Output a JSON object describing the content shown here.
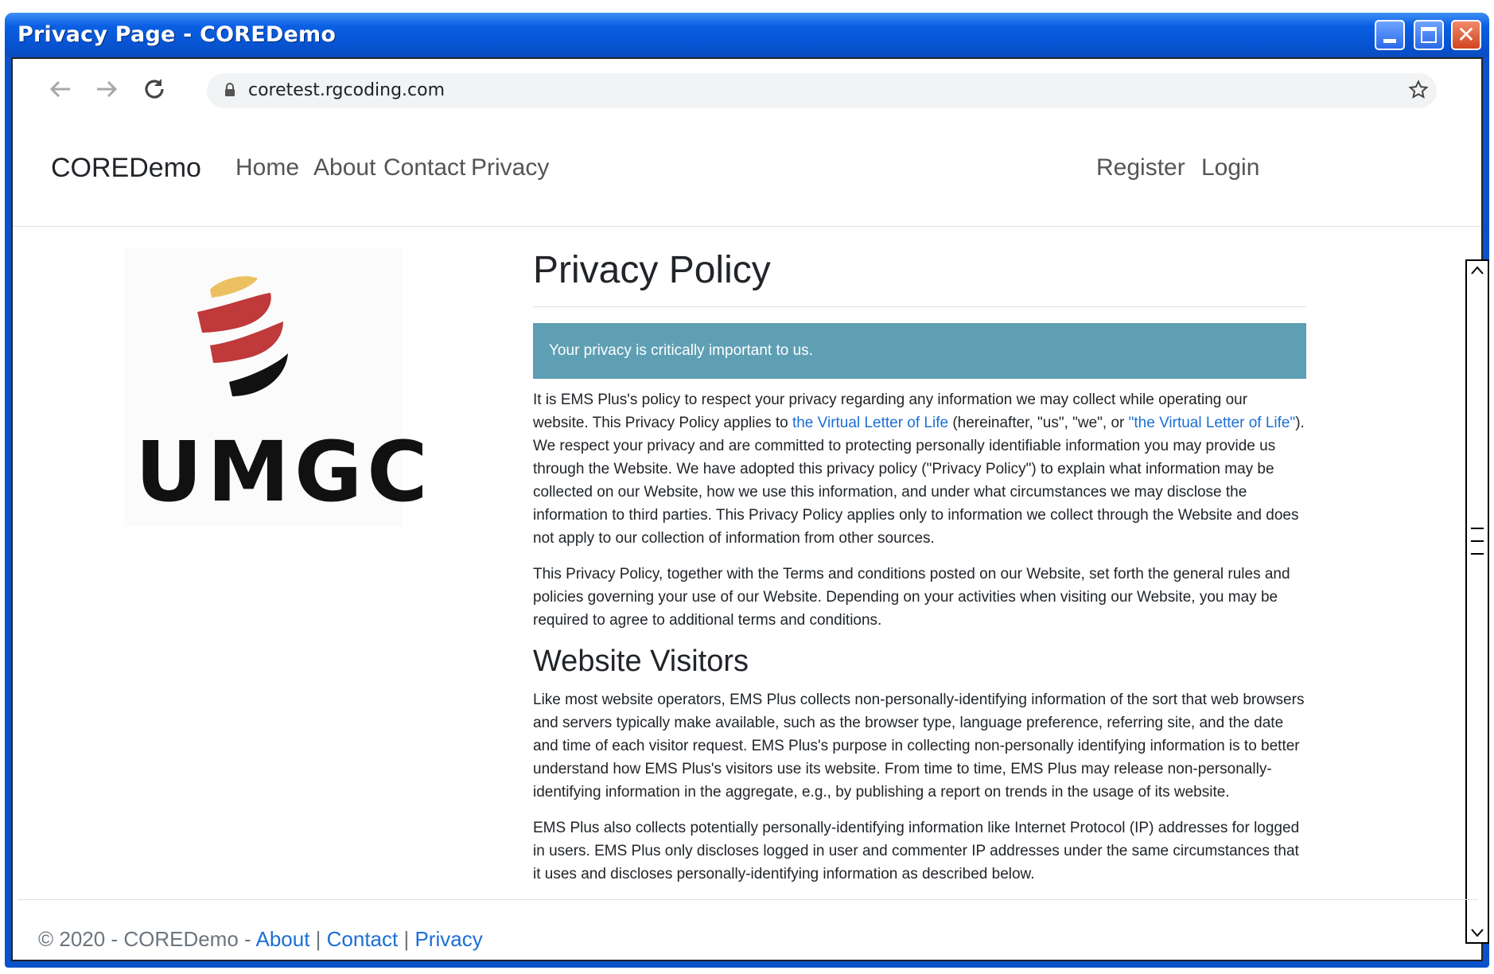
{
  "window": {
    "title": "Privacy Page - COREDemo"
  },
  "browser": {
    "url": "coretest.rgcoding.com"
  },
  "site": {
    "brand": "COREDemo",
    "nav_left": [
      "Home",
      "About",
      "Contact",
      "Privacy"
    ],
    "nav_right": [
      "Register",
      "Login"
    ]
  },
  "logo": {
    "text": "UMGC"
  },
  "page": {
    "title": "Privacy Policy",
    "alert": "Your privacy is critically important to us.",
    "p1": {
      "a": "It is EMS Plus's policy to respect your privacy regarding any information we may collect while operating our website. This Privacy Policy applies to ",
      "link1": "the Virtual Letter of Life",
      "b": " (hereinafter, \"us\", \"we\", or ",
      "link2": "\"the Virtual Letter of Life\"",
      "c": "). We respect your privacy and are committed to protecting personally identifiable information you may provide us through the Website. We have adopted this privacy policy (\"Privacy Policy\") to explain what information may be collected on our Website, how we use this information, and under what circumstances we may disclose the information to third parties. This Privacy Policy applies only to information we collect through the Website and does not apply to our collection of information from other sources."
    },
    "p2": "This Privacy Policy, together with the Terms and conditions posted on our Website, set forth the general rules and policies governing your use of our Website. Depending on your activities when visiting our Website, you may be required to agree to additional terms and conditions.",
    "h2": "Website Visitors",
    "p3": "Like most website operators, EMS Plus collects non-personally-identifying information of the sort that web browsers and servers typically make available, such as the browser type, language preference, referring site, and the date and time of each visitor request. EMS Plus's purpose in collecting non-personally identifying information is to better understand how EMS Plus's visitors use its website. From time to time, EMS Plus may release non-personally-identifying information in the aggregate, e.g., by publishing a report on trends in the usage of its website.",
    "p4": "EMS Plus also collects potentially personally-identifying information like Internet Protocol (IP) addresses for logged in users. EMS Plus only discloses logged in user and commenter IP addresses under the same circumstances that it uses and discloses personally-identifying information as described below."
  },
  "footer": {
    "copyright": "© 2020 - COREDemo - ",
    "links": [
      "About",
      "Contact",
      "Privacy"
    ],
    "sep": " | "
  },
  "colors": {
    "title_bar": "#0754d3",
    "alert_bg": "#5e9fb3",
    "link": "#1a6fd6",
    "logo_gold": "#ecc061",
    "logo_red": "#c0393b"
  }
}
